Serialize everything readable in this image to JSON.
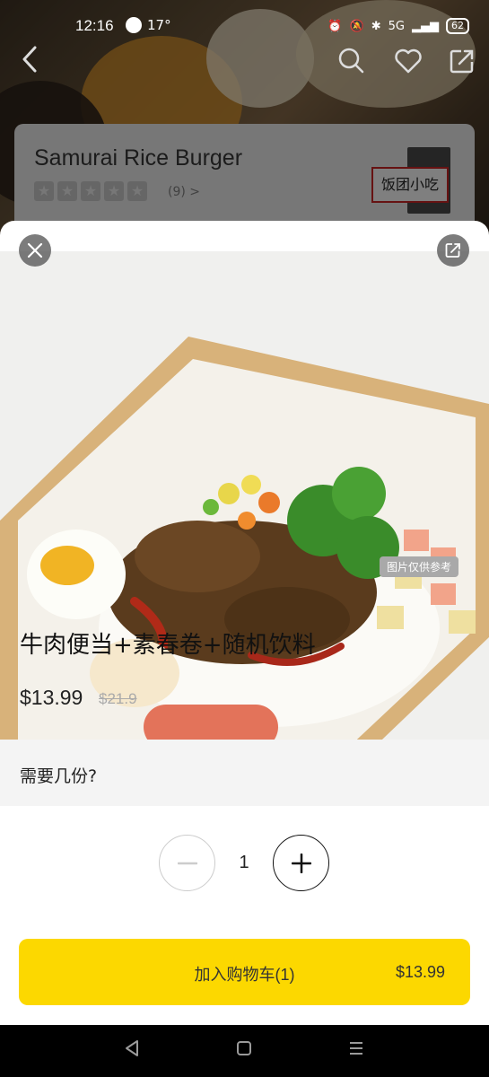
{
  "status_bar": {
    "time": "12:16",
    "temperature": "17°",
    "network": "5G",
    "battery": "62"
  },
  "nav": {
    "back_icon": "back-chevron-icon",
    "search_icon": "search-icon",
    "favorite_icon": "heart-icon",
    "share_icon": "share-icon"
  },
  "store": {
    "name": "Samurai Rice Burger",
    "rating_count": "(9) >",
    "logo_text": "饭团小吃"
  },
  "item": {
    "title": "牛肉便当+素春卷+随机饮料",
    "price": "$13.99",
    "original_price": "$21.9",
    "photo_note": "图片仅供参考"
  },
  "quantity": {
    "question": "需要几份?",
    "value": "1"
  },
  "add_to_cart": {
    "label": "加入购物车(1)",
    "price": "$13.99"
  },
  "colors": {
    "accent": "#fcd800"
  }
}
